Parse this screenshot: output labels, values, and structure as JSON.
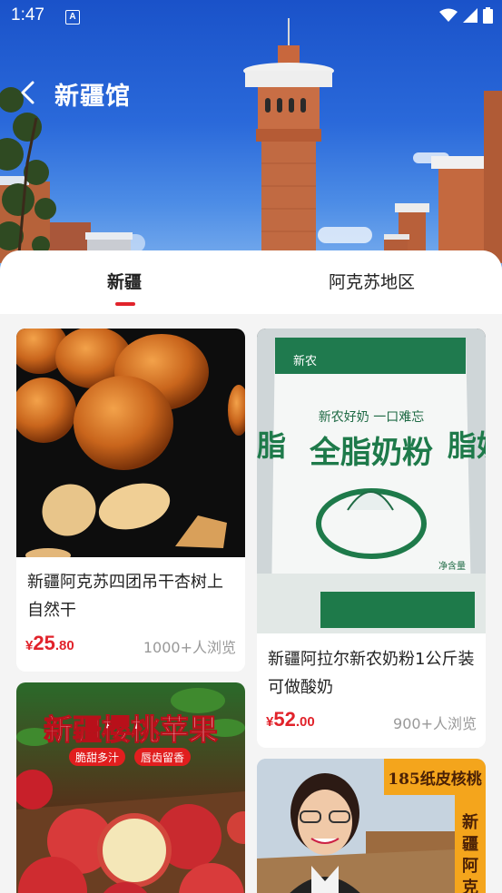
{
  "status_bar": {
    "time": "1:47",
    "notification_icon": "A"
  },
  "header": {
    "title": "新疆馆",
    "back_icon": "back-arrow-icon"
  },
  "tabs": [
    {
      "label": "新疆",
      "active": true
    },
    {
      "label": "阿克苏地区",
      "active": false
    }
  ],
  "accent_color": "#e1232b",
  "products": [
    {
      "title": "新疆阿克苏四团吊干杏树上自然干",
      "price_currency": "¥",
      "price_int": "25",
      "price_dec": ".80",
      "views": "1000+人浏览"
    },
    {
      "title": "新疆阿拉尔新农奶粉1公斤装可做酸奶",
      "price_currency": "¥",
      "price_int": "52",
      "price_dec": ".00",
      "views": "900+人浏览",
      "image_text": {
        "brand": "新农",
        "slogan": "新农好奶 一口难忘",
        "name": "全脂奶粉",
        "weight": "净含量",
        "side_text": "脂奶"
      }
    },
    {
      "image_text": {
        "headline": "新疆樱桃苹果",
        "tag1": "脆甜多汁",
        "tag2": "唇齿留香"
      }
    },
    {
      "image_text": {
        "banner": "185纸皮核桃",
        "side": "新疆阿克苏"
      }
    }
  ]
}
